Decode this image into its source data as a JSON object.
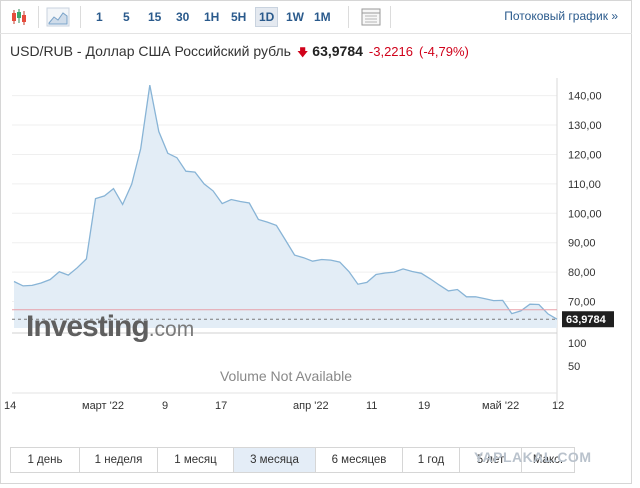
{
  "toolbar": {
    "timeframes": [
      "1",
      "5",
      "15",
      "30",
      "1H",
      "5H",
      "1D",
      "1W",
      "1M"
    ],
    "active_timeframe": "1D",
    "stream_link": "Потоковый график »"
  },
  "header": {
    "instrument": "USD/RUB - Доллар США Российский рубль",
    "price": "63,9784",
    "change": "-3,2216",
    "change_pct": "(-4,79%)",
    "down_color": "#d0021b"
  },
  "chart_data": {
    "type": "area",
    "title": "USD/RUB - Доллар США Российский рубль",
    "x_tick_labels": [
      "14",
      "март '22",
      "9",
      "17",
      "апр '22",
      "11",
      "19",
      "май '22",
      "12"
    ],
    "y_tick_labels": [
      "70,00",
      "80,00",
      "90,00",
      "100,00",
      "110,00",
      "120,00",
      "130,00",
      "140,00"
    ],
    "ylim": [
      61,
      146
    ],
    "last_value_label": "63,9784",
    "last_value": 63.9784,
    "volume_axis_labels": [
      "100",
      "50"
    ],
    "volume_text": "Volume Not Available",
    "watermark": "Investing.com",
    "line_color": "#88b4d6",
    "fill_color": "#e3edf6",
    "series": [
      {
        "values": [
          76.8,
          75.3,
          75.5,
          76.3,
          77.5,
          80.1,
          79.0,
          81.5,
          84.5,
          105.0,
          105.9,
          108.4,
          103.0,
          109.9,
          122.0,
          143.6,
          127.8,
          120.4,
          118.9,
          114.3,
          114.0,
          110.0,
          107.6,
          103.3,
          104.7,
          104.0,
          103.5,
          97.9,
          97.0,
          95.9,
          90.9,
          85.8,
          84.9,
          83.7,
          84.3,
          84.1,
          83.4,
          80.2,
          75.9,
          76.5,
          79.2,
          79.7,
          80.0,
          81.1,
          80.2,
          79.6,
          77.7,
          75.6,
          73.6,
          74.1,
          71.6,
          71.6,
          71.0,
          70.3,
          70.4,
          65.9,
          66.8,
          69.1,
          69.0,
          65.8,
          63.98
        ]
      }
    ]
  },
  "ranges": {
    "items": [
      "1 день",
      "1 неделя",
      "1 месяц",
      "3 месяца",
      "6 месяцев",
      "1 год",
      "5 лет",
      "Макс."
    ],
    "active": "3 месяца"
  },
  "corner_watermark": "YAPLAKAL.COM"
}
